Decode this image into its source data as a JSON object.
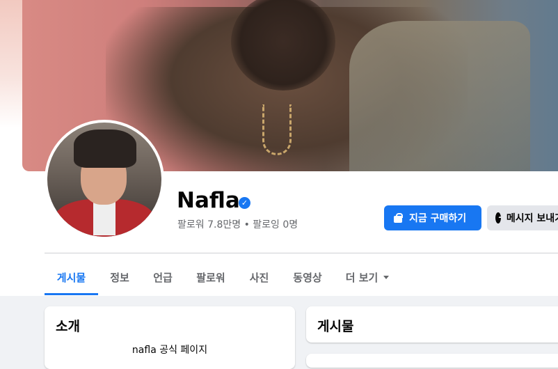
{
  "profile": {
    "name": "Nafla",
    "verified_mark": "✓",
    "followers_line": "팔로워 7.8만명 • 팔로잉 0명"
  },
  "actions": {
    "buy_label": "지금 구매하기",
    "buy_icon": "shopping-bag-icon",
    "message_label": "메시지 보내기",
    "message_icon": "messenger-icon"
  },
  "tabs": [
    {
      "label": "게시물",
      "active": true
    },
    {
      "label": "정보"
    },
    {
      "label": "언급"
    },
    {
      "label": "팔로워"
    },
    {
      "label": "사진"
    },
    {
      "label": "동영상"
    },
    {
      "label": "더 보기"
    }
  ],
  "intro": {
    "title": "소개",
    "text": "nafla 공식 페이지"
  },
  "posts": {
    "title": "게시물"
  },
  "colors": {
    "accent": "#1877f2",
    "page_bg": "#f0f2f5",
    "secondary_text": "#65676b"
  }
}
